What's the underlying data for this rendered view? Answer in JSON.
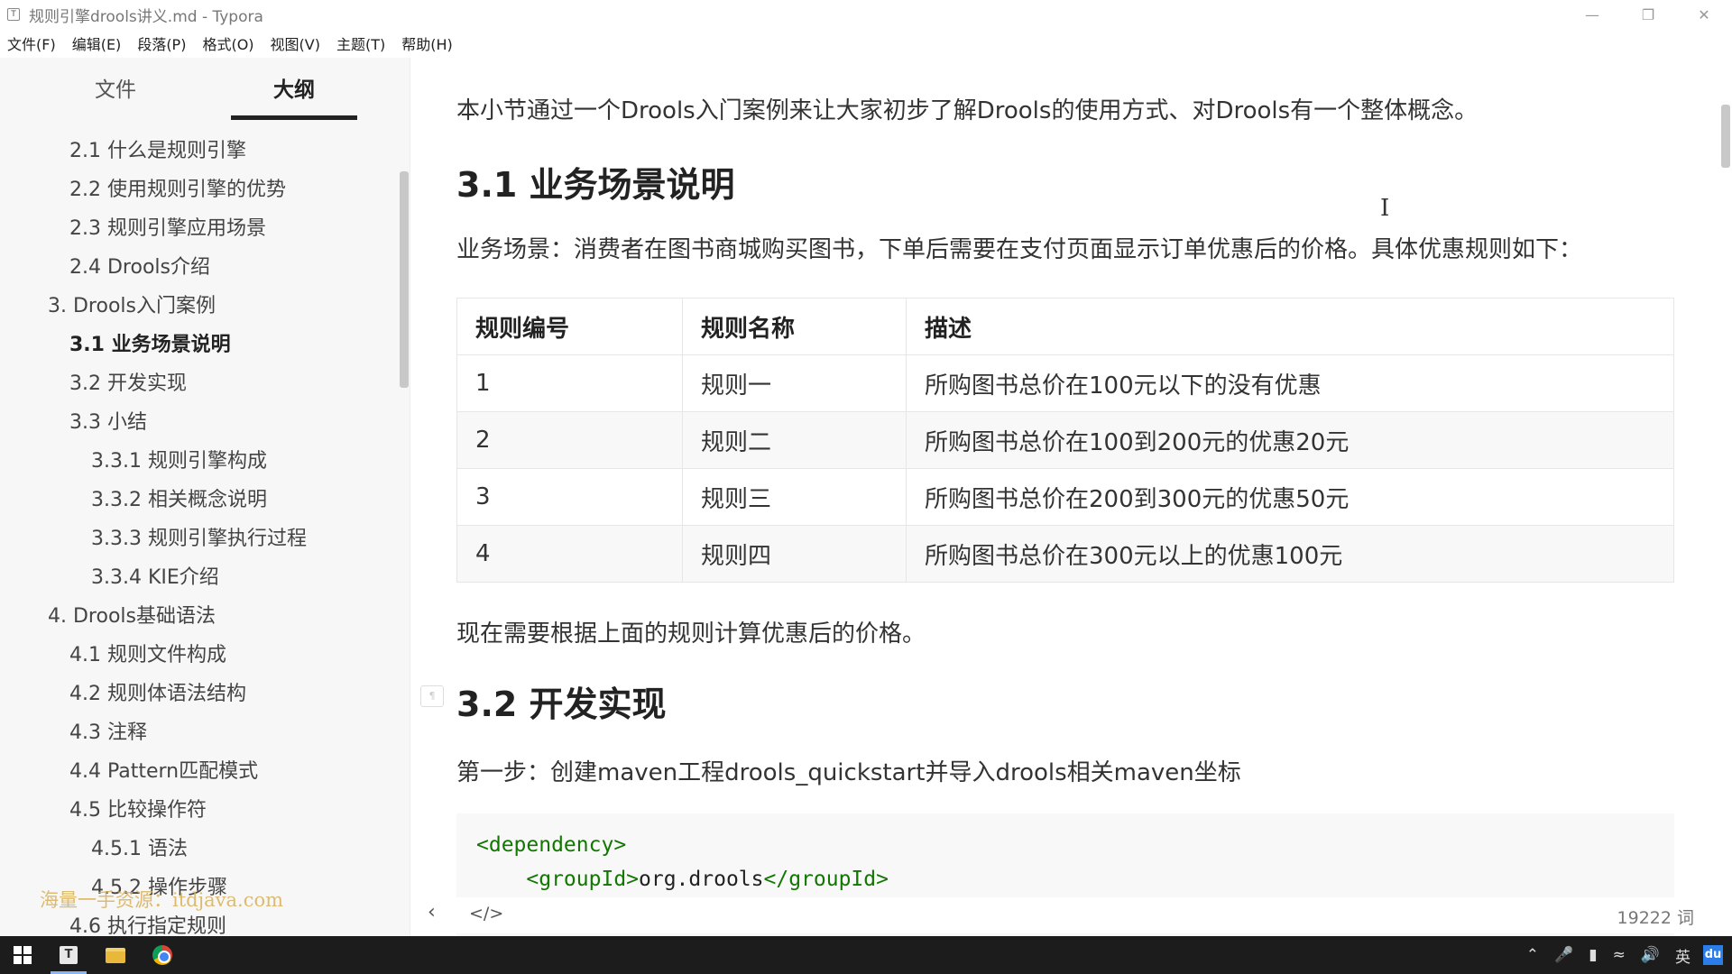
{
  "window": {
    "title": "规则引擎drools讲义.md - Typora",
    "app_icon": "T"
  },
  "menu": [
    "文件(F)",
    "编辑(E)",
    "段落(P)",
    "格式(O)",
    "视图(V)",
    "主题(T)",
    "帮助(H)"
  ],
  "sidebar": {
    "tabs": [
      {
        "label": "文件",
        "active": false
      },
      {
        "label": "大纲",
        "active": true
      }
    ],
    "outline": [
      {
        "label": "2.1 什么是规则引擎",
        "level": 2
      },
      {
        "label": "2.2 使用规则引擎的优势",
        "level": 2
      },
      {
        "label": "2.3 规则引擎应用场景",
        "level": 2
      },
      {
        "label": "2.4 Drools介绍",
        "level": 2
      },
      {
        "label": "3. Drools入门案例",
        "level": 1
      },
      {
        "label": "3.1 业务场景说明",
        "level": 2,
        "active": true
      },
      {
        "label": "3.2 开发实现",
        "level": 2
      },
      {
        "label": "3.3 小结",
        "level": 2
      },
      {
        "label": "3.3.1 规则引擎构成",
        "level": 3
      },
      {
        "label": "3.3.2 相关概念说明",
        "level": 3
      },
      {
        "label": "3.3.3 规则引擎执行过程",
        "level": 3
      },
      {
        "label": "3.3.4 KIE介绍",
        "level": 3
      },
      {
        "label": "4. Drools基础语法",
        "level": 1
      },
      {
        "label": "4.1 规则文件构成",
        "level": 2
      },
      {
        "label": "4.2 规则体语法结构",
        "level": 2
      },
      {
        "label": "4.3 注释",
        "level": 2
      },
      {
        "label": "4.4 Pattern匹配模式",
        "level": 2
      },
      {
        "label": "4.5 比较操作符",
        "level": 2
      },
      {
        "label": "4.5.1 语法",
        "level": 3
      },
      {
        "label": "4.5.2 操作步骤",
        "level": 3
      },
      {
        "label": "4.6 执行指定规则",
        "level": 2
      }
    ],
    "watermark": "海量一手资源：itdjava.com"
  },
  "document": {
    "intro": "本小节通过一个Drools入门案例来让大家初步了解Drools的使用方式、对Drools有一个整体概念。",
    "heading_31": "3.1 业务场景说明",
    "scenario": "业务场景：消费者在图书商城购买图书，下单后需要在支付页面显示订单优惠后的价格。具体优惠规则如下：",
    "table": {
      "headers": [
        "规则编号",
        "规则名称",
        "描述"
      ],
      "rows": [
        [
          "1",
          "规则一",
          "所购图书总价在100元以下的没有优惠"
        ],
        [
          "2",
          "规则二",
          "所购图书总价在100到200元的优惠20元"
        ],
        [
          "3",
          "规则三",
          "所购图书总价在200到300元的优惠50元"
        ],
        [
          "4",
          "规则四",
          "所购图书总价在300元以上的优惠100元"
        ]
      ]
    },
    "after_table": "现在需要根据上面的规则计算优惠后的价格。",
    "heading_32": "3.2 开发实现",
    "step1": "第一步：创建maven工程drools_quickstart并导入drools相关maven坐标",
    "code": {
      "line1_tag": "<dependency>",
      "line2_open": "<groupId>",
      "line2_text": "org.drools",
      "line2_close": "</groupId>"
    }
  },
  "footer": {
    "back_icon": "‹",
    "source_icon": "</>",
    "word_count": "19222 词"
  },
  "taskbar": {
    "tray_lang": "英",
    "tray_du": "du"
  }
}
